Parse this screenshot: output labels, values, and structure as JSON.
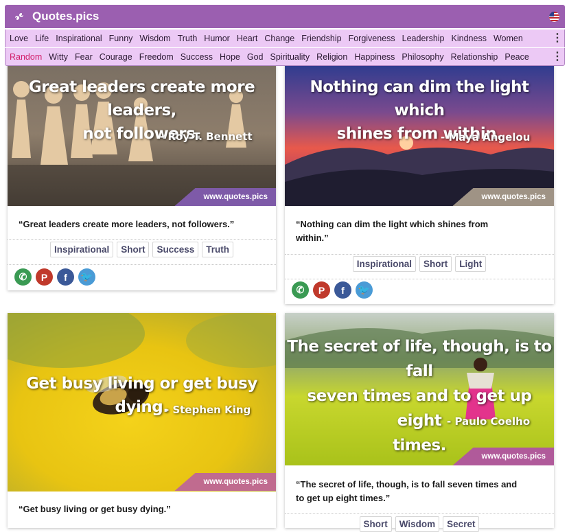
{
  "header": {
    "site_name": "Quotes.pics",
    "logo_icon": "quote-marks-icon",
    "flag_icon": "us-flag-icon"
  },
  "nav": {
    "row1": [
      "Love",
      "Life",
      "Inspirational",
      "Funny",
      "Wisdom",
      "Truth",
      "Humor",
      "Heart",
      "Change",
      "Friendship",
      "Forgiveness",
      "Leadership",
      "Kindness",
      "Women"
    ],
    "row2": [
      "Random",
      "Witty",
      "Fear",
      "Courage",
      "Freedom",
      "Success",
      "Hope",
      "God",
      "Spirituality",
      "Religion",
      "Happiness",
      "Philosophy",
      "Relationship",
      "Peace"
    ],
    "active": "Random",
    "more_icon": "kebab-menu-icon"
  },
  "colors": {
    "header_bg": "#9b5fb0",
    "nav_bg": "#ecc9f5",
    "active_nav": "#d21f6a",
    "watermark_bg": "#7e5aa8",
    "whatsapp": "#3a9a53",
    "pinterest": "#c0392b",
    "facebook": "#3b5998",
    "twitter": "#4a9bd6"
  },
  "watermark": "www.quotes.pics",
  "cards": [
    {
      "overlay": [
        "Great leaders create more leaders,",
        "not followers."
      ],
      "author": "- Roy T. Bennett",
      "quote": "“Great leaders create more leaders, not followers.”",
      "tags": [
        "Inspirational",
        "Short",
        "Success",
        "Truth"
      ]
    },
    {
      "overlay": [
        "Nothing can dim the light which",
        "shines from within."
      ],
      "author": "- Maya Angelou",
      "quote_lines": [
        "“Nothing can dim the light which shines from",
        "within.”"
      ],
      "tags": [
        "Inspirational",
        "Short",
        "Light"
      ]
    },
    {
      "overlay": [
        "Get busy living or get busy dying."
      ],
      "author": "- Stephen King",
      "quote": "“Get busy living or get busy dying.”"
    },
    {
      "overlay": [
        "The secret of life, though, is to fall",
        "seven times and to get up eight",
        "times."
      ],
      "author": "- Paulo Coelho",
      "quote_lines": [
        "“The secret of life, though, is to fall seven times and",
        "to get up eight times.”"
      ],
      "tags": [
        "Short",
        "Wisdom",
        "Secret"
      ]
    }
  ],
  "social": [
    {
      "name": "whatsapp-icon",
      "glyph": "✆"
    },
    {
      "name": "pinterest-icon",
      "glyph": "P"
    },
    {
      "name": "facebook-icon",
      "glyph": "f"
    },
    {
      "name": "twitter-icon",
      "glyph": "🐦"
    }
  ]
}
